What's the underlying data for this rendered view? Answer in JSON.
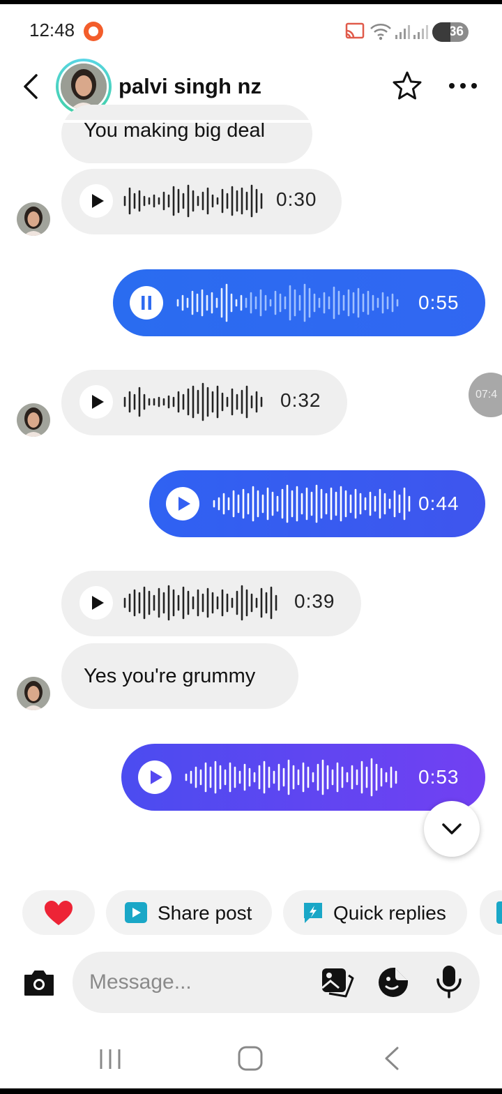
{
  "status_bar": {
    "time": "12:48",
    "battery": "36"
  },
  "header": {
    "contact_name": "palvi singh nz"
  },
  "messages": [
    {
      "from": "them",
      "type": "text",
      "text": "You making big deal"
    },
    {
      "from": "them",
      "type": "audio",
      "duration": "0:30",
      "state": "paused"
    },
    {
      "from": "me",
      "type": "audio",
      "duration": "0:55",
      "state": "playing"
    },
    {
      "from": "them",
      "type": "audio",
      "duration": "0:32",
      "state": "paused"
    },
    {
      "from": "me",
      "type": "audio",
      "duration": "0:44",
      "state": "paused"
    },
    {
      "from": "them",
      "type": "audio",
      "duration": "0:39",
      "state": "paused"
    },
    {
      "from": "them",
      "type": "text",
      "text": "Yes you're grummy"
    },
    {
      "from": "me",
      "type": "audio",
      "duration": "0:53",
      "state": "paused"
    }
  ],
  "time_chip": "07:4",
  "quick_actions": {
    "heart": "heart",
    "share_post": "Share post",
    "quick_replies": "Quick replies"
  },
  "composer": {
    "placeholder": "Message..."
  },
  "colors": {
    "outgoing_blue": "#2f6bf0",
    "outgoing_purple": "#6d3ff2",
    "incoming": "#efefef"
  }
}
